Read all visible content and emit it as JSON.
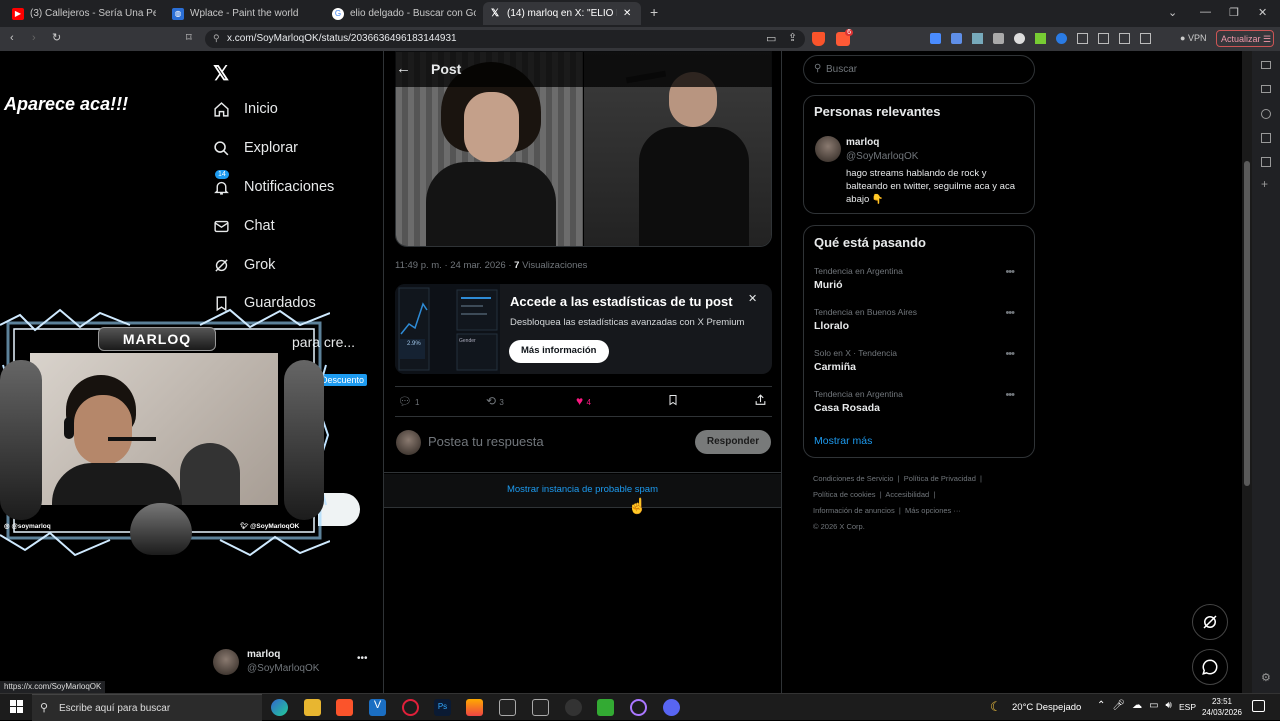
{
  "browser": {
    "tabs": [
      {
        "title": "(3) Callejeros - Sería Una Pena (l...",
        "icon": "youtube-icon"
      },
      {
        "title": "Wplace - Paint the world",
        "icon": "globe-icon"
      },
      {
        "title": "elio delgado - Buscar con Google",
        "icon": "google-icon"
      },
      {
        "title": "(14) marloq en X: \"ELIO DELGA...",
        "icon": "x-icon"
      }
    ],
    "url": "x.com/SoyMarloqOK/status/2036636496183144931",
    "vpn_label": "VPN",
    "update_label": "Actualizar",
    "shield_badge": "6"
  },
  "sidebar": {
    "items": [
      {
        "label": "Inicio",
        "icon": "home-icon"
      },
      {
        "label": "Explorar",
        "icon": "search-icon"
      },
      {
        "label": "Notificaciones",
        "icon": "bell-icon",
        "badge": "14"
      },
      {
        "label": "Chat",
        "icon": "mail-icon"
      },
      {
        "label": "Grok",
        "icon": "grok-icon"
      },
      {
        "label": "Guardados",
        "icon": "bookmark-icon"
      }
    ],
    "partial_premium": "para cre...",
    "discount_badge": "Descuento",
    "profile": {
      "name": "marloq",
      "handle": "@SoyMarloqOK"
    }
  },
  "overlay": {
    "caption": "Aparece aca!!!",
    "streamer_name": "MARLOQ",
    "instagram": "@soymarloq",
    "twitter": "@SoyMarloqOK"
  },
  "post": {
    "header_title": "Post",
    "meta_time": "11:49 p. m. · 24 mar. 2026 · ",
    "meta_views_count": "7",
    "meta_views_label": " Visualizaciones",
    "promo": {
      "title": "Accede a las estadísticas de tu post",
      "subtitle": "Desbloquea las estadísticas avanzadas con X Premium",
      "button": "Más información",
      "chart_label_1": "2.9%",
      "chart_label_2": "Gender"
    },
    "stats": {
      "replies": "1",
      "reposts": "3",
      "likes": "4"
    },
    "reply_placeholder": "Postea tu respuesta",
    "reply_button": "Responder",
    "spam_link": "Mostrar instancia de probable spam"
  },
  "right": {
    "search_placeholder": "Buscar",
    "relevant": {
      "heading": "Personas relevantes",
      "name": "marloq",
      "handle": "@SoyMarloqOK",
      "bio": "hago streams hablando de rock y balteando en twitter, seguilme aca y aca abajo 👇"
    },
    "trending": {
      "heading": "Qué está pasando",
      "items": [
        {
          "context": "Tendencia en Argentina",
          "title": "Murió"
        },
        {
          "context": "Tendencia en Buenos Aires",
          "title": "Lloralo"
        },
        {
          "context": "Solo en X · Tendencia",
          "title": "Carmiña"
        },
        {
          "context": "Tendencia en Argentina",
          "title": "Casa Rosada"
        }
      ],
      "show_more": "Mostrar más"
    },
    "footer": {
      "links": [
        "Condiciones de Servicio",
        "Política de Privacidad",
        "Política de cookies",
        "Accesibilidad",
        "Información de anuncios",
        "Más opciones ···"
      ],
      "copyright": "© 2026 X Corp."
    }
  },
  "status_bar_url": "https://x.com/SoyMarloqOK",
  "taskbar": {
    "search_placeholder": "Escribe aquí para buscar",
    "weather": "20°C  Despejado",
    "lang": "ESP",
    "time": "23:51",
    "date": "24/03/2026"
  }
}
